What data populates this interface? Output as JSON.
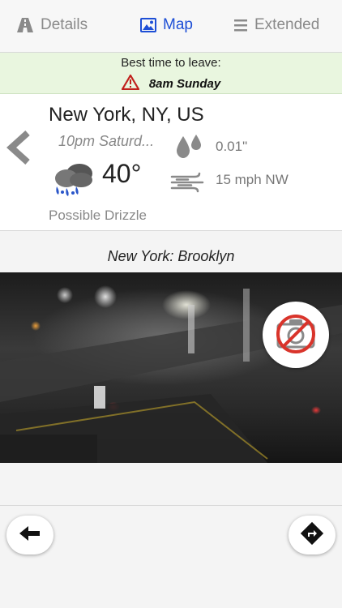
{
  "tabs": {
    "details": {
      "label": "Details",
      "icon": "road-icon"
    },
    "map": {
      "label": "Map",
      "icon": "picture-icon"
    },
    "extended": {
      "label": "Extended",
      "icon": "list-icon"
    },
    "active": "map",
    "active_color": "#1e4fd6"
  },
  "banner": {
    "label": "Best time to leave:",
    "time": "8am Sunday",
    "icon": "warning-icon",
    "background": "#e9f6df"
  },
  "weather": {
    "location": "New York, NY, US",
    "time": "10pm Saturd...",
    "precip": "0.01\"",
    "temperature": "40°",
    "wind": "15 mph NW",
    "summary": "Possible Drizzle",
    "condition_icon": "rain-cloud-icon"
  },
  "camera": {
    "title": "New York: Brooklyn",
    "disable_icon": "no-camera-icon"
  },
  "nav": {
    "back_icon": "arrow-left-icon",
    "route_icon": "directions-icon"
  }
}
